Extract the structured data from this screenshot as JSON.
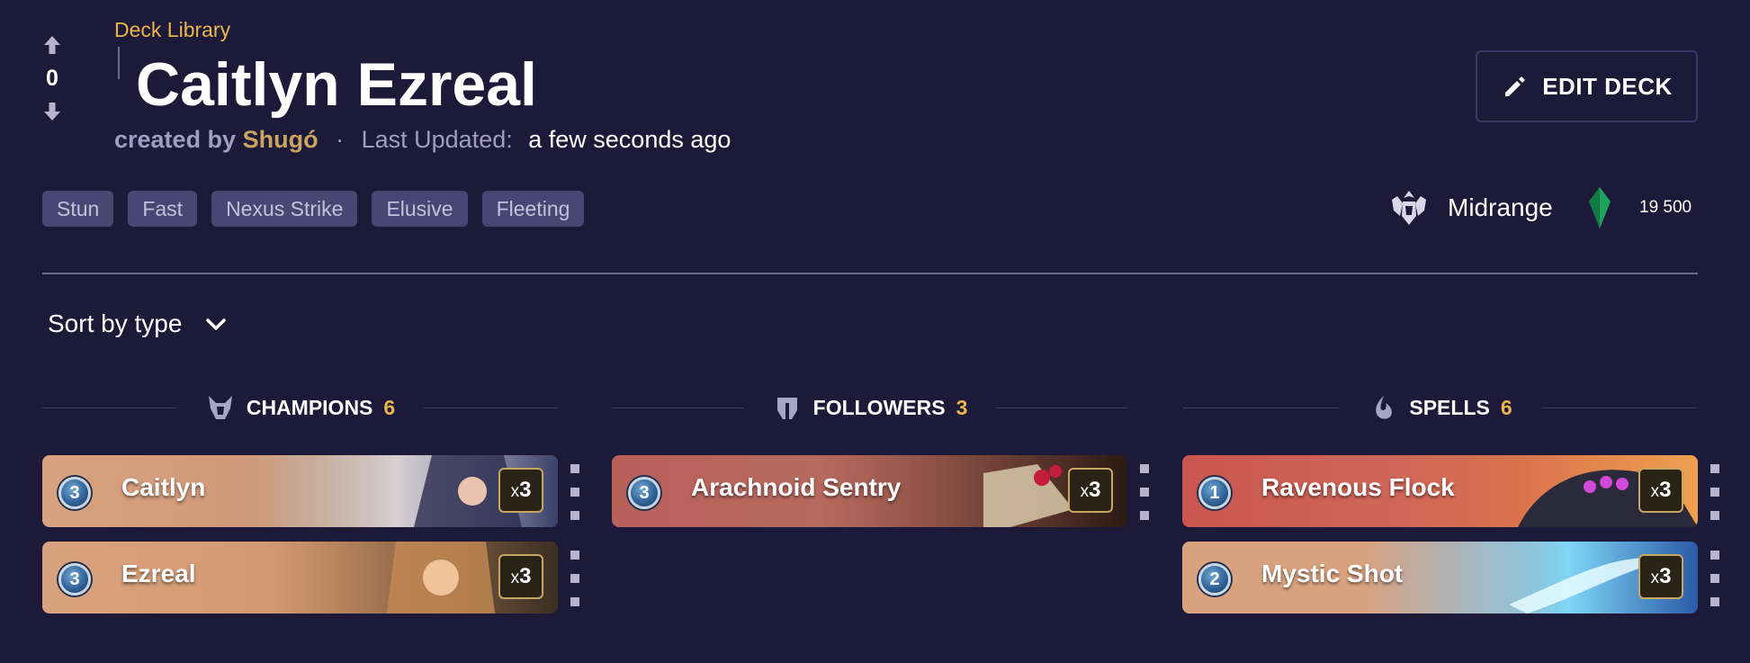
{
  "header": {
    "breadcrumb": "Deck Library",
    "title": "Caitlyn Ezreal",
    "vote_count": "0",
    "created_by_label": "created by",
    "author": "Shugó",
    "separator": "·",
    "last_updated_label": "Last Updated:",
    "last_updated_value": "a few seconds ago",
    "edit_button_label": "EDIT DECK"
  },
  "tags": [
    "Stun",
    "Fast",
    "Nexus Strike",
    "Elusive",
    "Fleeting"
  ],
  "deck_info": {
    "archetype": "Midrange",
    "shard_cost": "19 500"
  },
  "sort": {
    "label": "Sort by type"
  },
  "columns": [
    {
      "name": "CHAMPIONS",
      "count": "6",
      "icon": "champion-icon",
      "cards": [
        {
          "cost": "3",
          "name": "Caitlyn",
          "qty_prefix": "x",
          "qty": "3"
        },
        {
          "cost": "3",
          "name": "Ezreal",
          "qty_prefix": "x",
          "qty": "3"
        }
      ]
    },
    {
      "name": "FOLLOWERS",
      "count": "3",
      "icon": "follower-icon",
      "cards": [
        {
          "cost": "3",
          "name": "Arachnoid Sentry",
          "qty_prefix": "x",
          "qty": "3"
        }
      ]
    },
    {
      "name": "SPELLS",
      "count": "6",
      "icon": "spell-icon",
      "cards": [
        {
          "cost": "1",
          "name": "Ravenous Flock",
          "qty_prefix": "x",
          "qty": "3"
        },
        {
          "cost": "2",
          "name": "Mystic Shot",
          "qty_prefix": "x",
          "qty": "3"
        }
      ]
    }
  ],
  "colors": {
    "background": "#1d1938",
    "accent_gold": "#e8b64d",
    "tag_bg": "#4a4673",
    "text_muted": "#a19cc2"
  }
}
